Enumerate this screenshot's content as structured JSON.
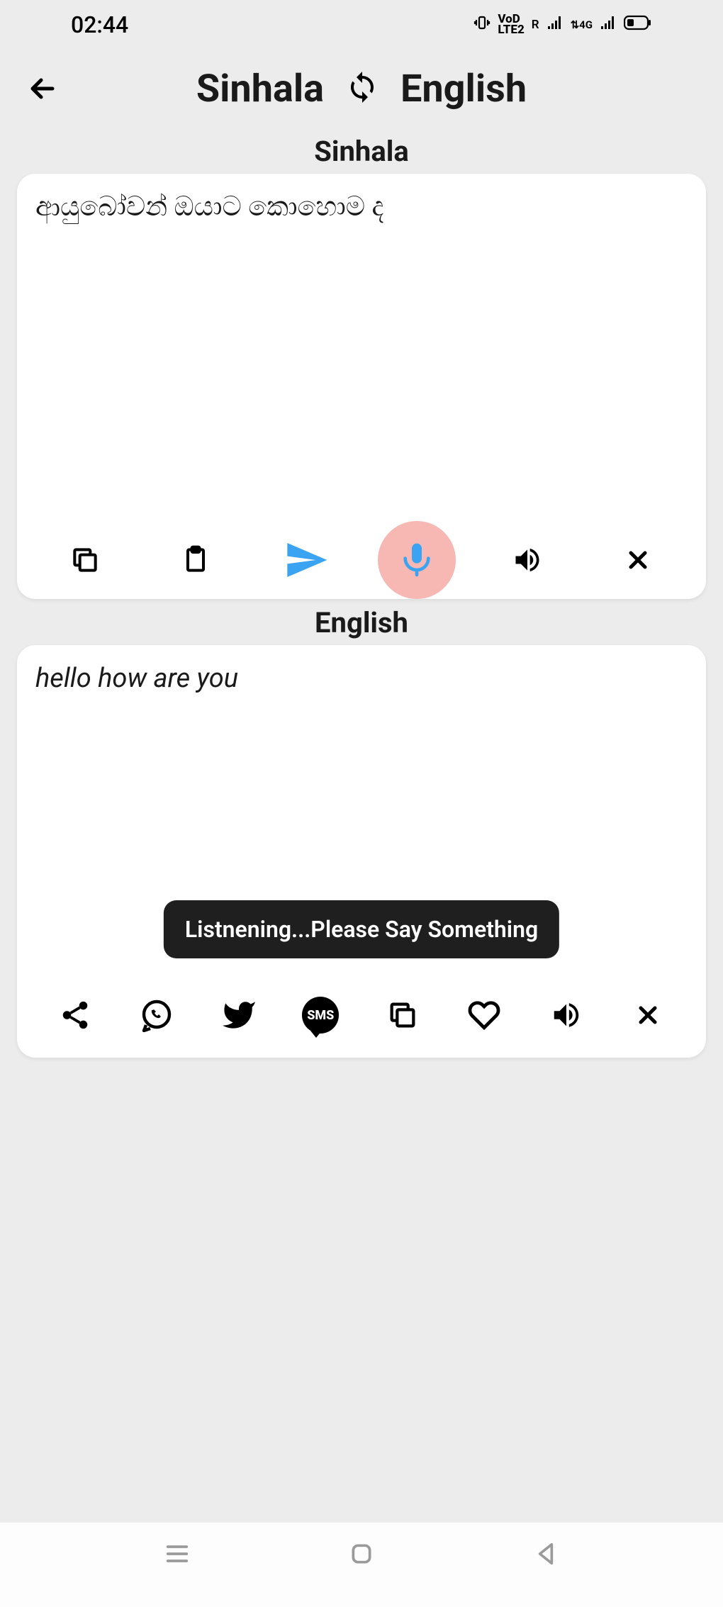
{
  "status": {
    "time": "02:44",
    "indicators_label": "VoLTE R 4G"
  },
  "header": {
    "source_lang": "Sinhala",
    "target_lang": "English"
  },
  "source": {
    "label": "Sinhala",
    "text": "ආයුබෝවන් ඔයාට කොහොම ද"
  },
  "target": {
    "label": "English",
    "text": "hello how are you"
  },
  "toast": {
    "message": "Listnening...Please Say Something"
  },
  "share": {
    "sms_label": "SMS"
  }
}
